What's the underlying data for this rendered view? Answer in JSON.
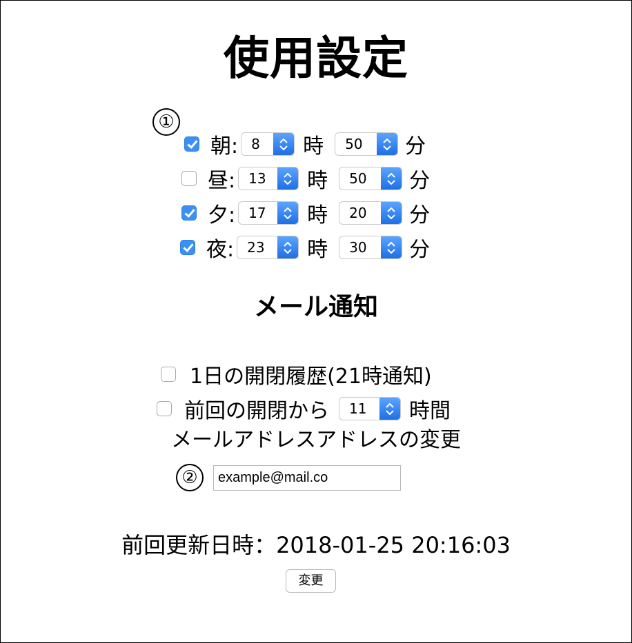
{
  "header": {
    "title": "使用設定"
  },
  "markers": {
    "first": "①",
    "second": "②"
  },
  "schedule": {
    "hour_unit": "時",
    "minute_unit": "分",
    "rows": [
      {
        "label": "朝:",
        "checked": true,
        "hour": "8",
        "minute": "50"
      },
      {
        "label": "昼:",
        "checked": false,
        "hour": "13",
        "minute": "50"
      },
      {
        "label": "夕:",
        "checked": true,
        "hour": "17",
        "minute": "20"
      },
      {
        "label": "夜:",
        "checked": true,
        "hour": "23",
        "minute": "30"
      }
    ]
  },
  "mail": {
    "title": "メール通知",
    "daily_history_label": "1日の開閉履歴(21時通知)",
    "daily_history_checked": false,
    "since_last_label": "前回の開閉から",
    "since_last_checked": false,
    "since_last_hours": "11",
    "since_last_unit": "時間",
    "address_change_label": "メールアドレスアドレスの変更",
    "email_value": "example@mail.co"
  },
  "footer": {
    "last_updated": "前回更新日時：2018-01-25 20:16:03",
    "change_button": "変更"
  },
  "colors": {
    "accent": "#3b8ff5"
  }
}
